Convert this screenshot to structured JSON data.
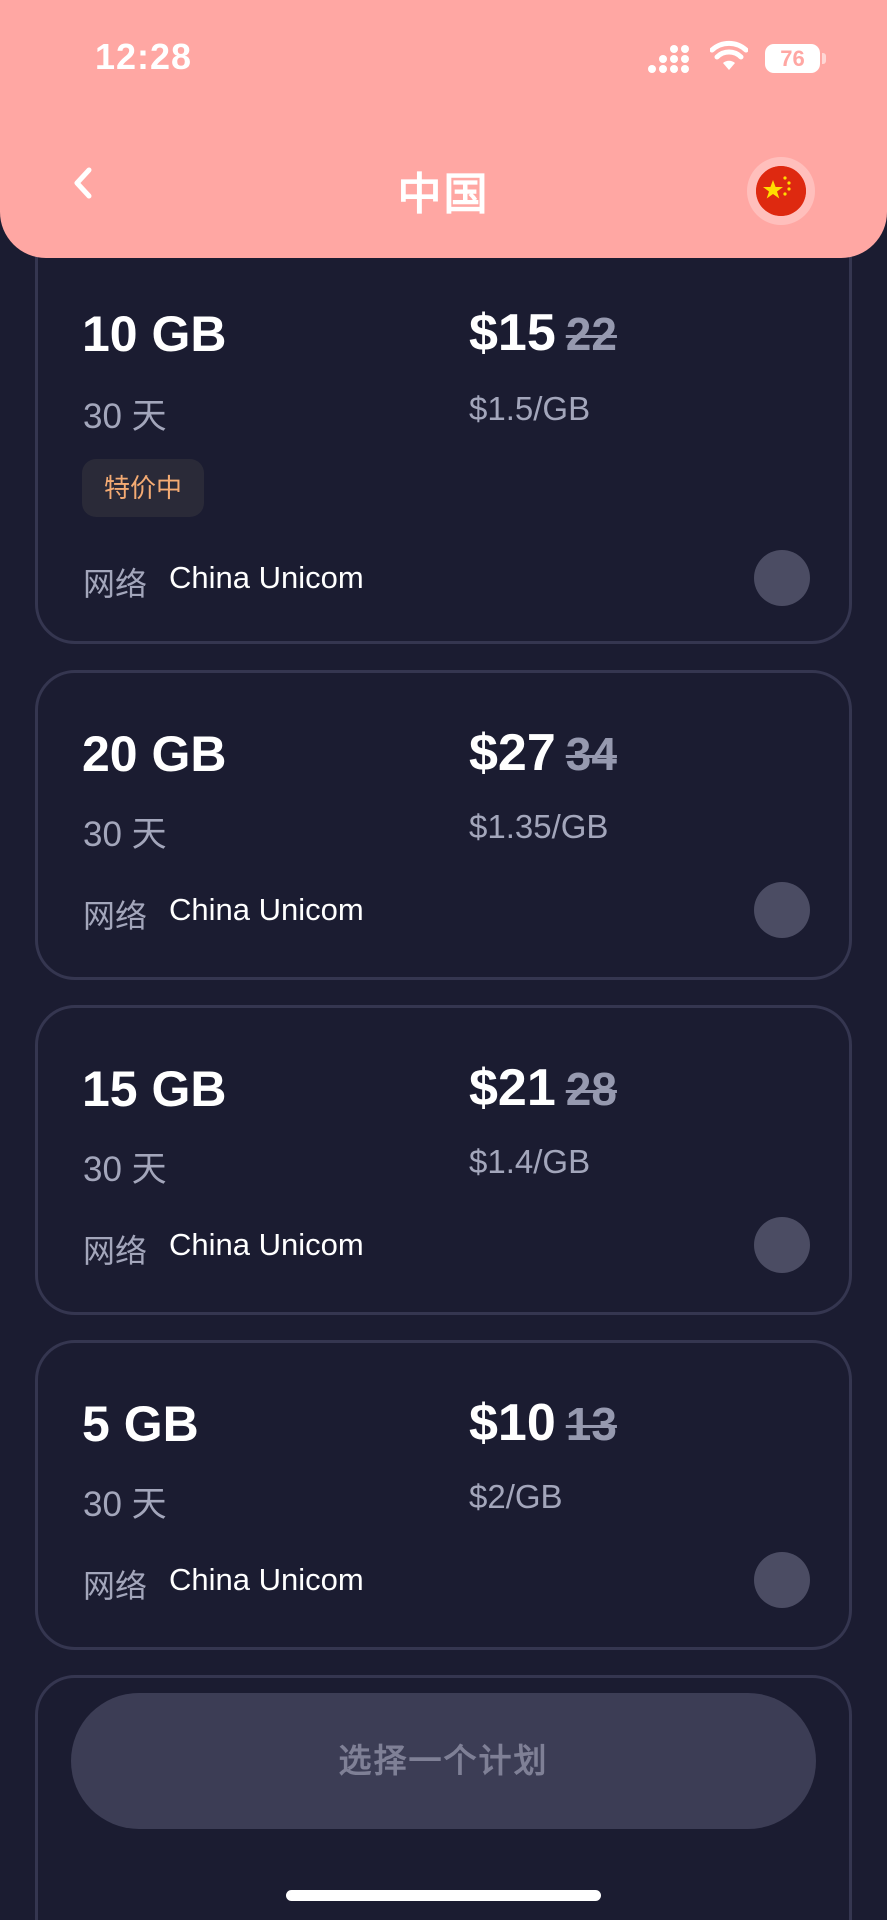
{
  "status_bar": {
    "time": "12:28",
    "battery": "76"
  },
  "header": {
    "title": "中国",
    "back_icon": "chevron-left-icon",
    "flag_icon": "china-flag-icon"
  },
  "plans": [
    {
      "data": "10 GB",
      "price": "$15",
      "old_price": "22",
      "duration": "30 天",
      "per_gb": "$1.5/GB",
      "badge": "特价中",
      "network_label": "网络",
      "network": "China Unicom",
      "selected": false
    },
    {
      "data": "20 GB",
      "price": "$27",
      "old_price": "34",
      "duration": "30 天",
      "per_gb": "$1.35/GB",
      "network_label": "网络",
      "network": "China Unicom",
      "selected": false
    },
    {
      "data": "15 GB",
      "price": "$21",
      "old_price": "28",
      "duration": "30 天",
      "per_gb": "$1.4/GB",
      "network_label": "网络",
      "network": "China Unicom",
      "selected": false
    },
    {
      "data": "5 GB",
      "price": "$10",
      "old_price": "13",
      "duration": "30 天",
      "per_gb": "$2/GB",
      "network_label": "网络",
      "network": "China Unicom",
      "selected": false
    }
  ],
  "cta": {
    "label": "选择一个计划"
  },
  "colors": {
    "header": "#ffa7a3",
    "background": "#1b1c31",
    "badge_text": "#f4ab73",
    "radio": "#4b4c63"
  }
}
